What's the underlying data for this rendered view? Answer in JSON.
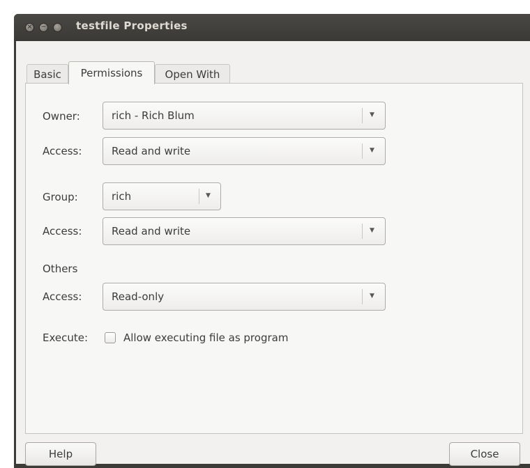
{
  "window": {
    "title": "testfile Properties"
  },
  "tabs": [
    {
      "label": "Basic"
    },
    {
      "label": "Permissions",
      "selected": true
    },
    {
      "label": "Open With"
    }
  ],
  "permissions": {
    "owner": {
      "label": "Owner:",
      "value": "rich - Rich Blum"
    },
    "owner_access": {
      "label": "Access:",
      "value": "Read and write"
    },
    "group": {
      "label": "Group:",
      "value": "rich"
    },
    "group_access": {
      "label": "Access:",
      "value": "Read and write"
    },
    "others": {
      "label": "Others"
    },
    "others_access": {
      "label": "Access:",
      "value": "Read-only"
    },
    "execute": {
      "label": "Execute:",
      "checkbox_label": "Allow executing file as program",
      "checked": false
    }
  },
  "buttons": {
    "help": "Help",
    "close": "Close"
  },
  "icons": {
    "window_close": "close-icon",
    "window_minimize": "minimize-icon",
    "window_maximize": "maximize-icon",
    "dropdown": "chevron-down-icon"
  }
}
